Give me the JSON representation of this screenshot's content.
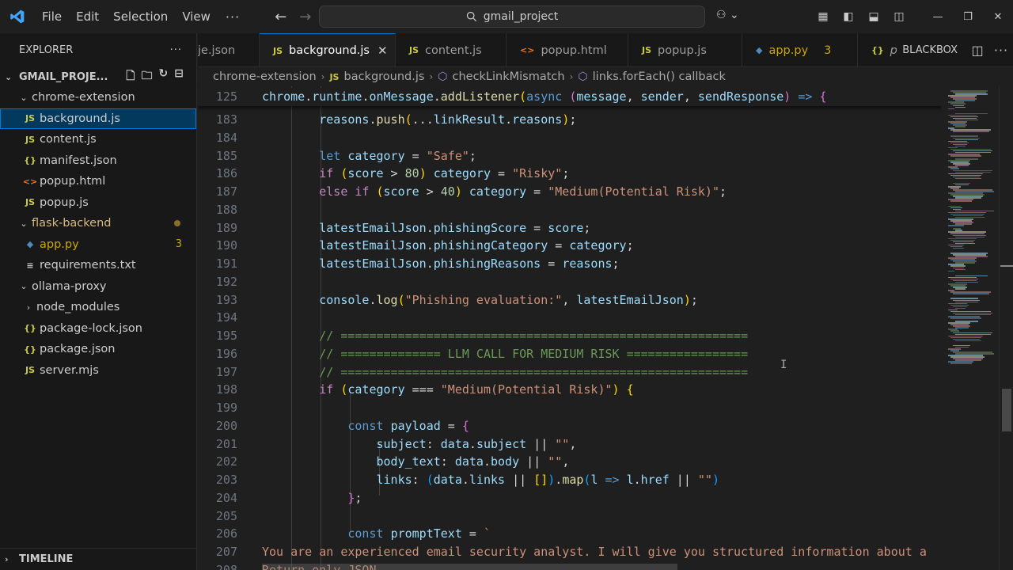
{
  "menu": [
    "File",
    "Edit",
    "Selection",
    "View"
  ],
  "command_center": "gmail_project",
  "sidebar": {
    "header": "EXPLORER",
    "section": "GMAIL_PROJE...",
    "tree": [
      {
        "label": "chrome-extension",
        "kind": "folder",
        "depth": 1,
        "expanded": true
      },
      {
        "label": "background.js",
        "kind": "js",
        "depth": 2,
        "selected": true
      },
      {
        "label": "content.js",
        "kind": "js",
        "depth": 2
      },
      {
        "label": "manifest.json",
        "kind": "json",
        "depth": 2
      },
      {
        "label": "popup.html",
        "kind": "html",
        "depth": 2
      },
      {
        "label": "popup.js",
        "kind": "js",
        "depth": 2
      },
      {
        "label": "flask-backend",
        "kind": "folder",
        "depth": 1,
        "expanded": true,
        "modified": true
      },
      {
        "label": "app.py",
        "kind": "py",
        "depth": 2,
        "badge": "3"
      },
      {
        "label": "requirements.txt",
        "kind": "txt",
        "depth": 2
      },
      {
        "label": "ollama-proxy",
        "kind": "folder",
        "depth": 1,
        "expanded": true
      },
      {
        "label": "node_modules",
        "kind": "folder",
        "depth": 2,
        "expanded": false
      },
      {
        "label": "package-lock.json",
        "kind": "json",
        "depth": 2
      },
      {
        "label": "package.json",
        "kind": "json",
        "depth": 2
      },
      {
        "label": "server.mjs",
        "kind": "js",
        "depth": 2
      }
    ],
    "timeline": "TIMELINE"
  },
  "tabs": [
    {
      "label": "je.json",
      "kind": "none"
    },
    {
      "label": "background.js",
      "kind": "js",
      "active": true
    },
    {
      "label": "content.js",
      "kind": "js"
    },
    {
      "label": "popup.html",
      "kind": "html"
    },
    {
      "label": "popup.js",
      "kind": "js"
    },
    {
      "label": "app.py",
      "kind": "py",
      "badge": "3"
    },
    {
      "label": "p",
      "kind": "json"
    }
  ],
  "blackbox": "BLACKBOX",
  "breadcrumb": [
    "chrome-extension",
    "background.js",
    "checkLinkMismatch",
    "links.forEach() callback"
  ],
  "editor": {
    "sticky": {
      "n": "125",
      "t": [
        [
          "v",
          "chrome"
        ],
        [
          "p",
          "."
        ],
        [
          "v",
          "runtime"
        ],
        [
          "p",
          "."
        ],
        [
          "v",
          "onMessage"
        ],
        [
          "p",
          "."
        ],
        [
          "f",
          "addListener"
        ],
        [
          "b1",
          "("
        ],
        [
          "k",
          "async"
        ],
        [
          "p",
          " "
        ],
        [
          "b2",
          "("
        ],
        [
          "v",
          "message"
        ],
        [
          "p",
          ", "
        ],
        [
          "v",
          "sender"
        ],
        [
          "p",
          ", "
        ],
        [
          "v",
          "sendResponse"
        ],
        [
          "b2",
          ")"
        ],
        [
          "p",
          " "
        ],
        [
          "k",
          "=>"
        ],
        [
          "p",
          " "
        ],
        [
          "b2",
          "{"
        ]
      ]
    },
    "lines": [
      {
        "n": "183",
        "t": [
          [
            "p",
            "        "
          ],
          [
            "v",
            "reasons"
          ],
          [
            "p",
            "."
          ],
          [
            "f",
            "push"
          ],
          [
            "b1",
            "("
          ],
          [
            "p",
            "..."
          ],
          [
            "v",
            "linkResult"
          ],
          [
            "p",
            "."
          ],
          [
            "v",
            "reasons"
          ],
          [
            "b1",
            ")"
          ],
          [
            "p",
            ";"
          ]
        ]
      },
      {
        "n": "184",
        "t": []
      },
      {
        "n": "185",
        "t": [
          [
            "p",
            "        "
          ],
          [
            "k",
            "let"
          ],
          [
            "p",
            " "
          ],
          [
            "v",
            "category"
          ],
          [
            "p",
            " = "
          ],
          [
            "s",
            "\"Safe\""
          ],
          [
            "p",
            ";"
          ]
        ]
      },
      {
        "n": "186",
        "t": [
          [
            "p",
            "        "
          ],
          [
            "c",
            "if"
          ],
          [
            "p",
            " "
          ],
          [
            "b1",
            "("
          ],
          [
            "v",
            "score"
          ],
          [
            "p",
            " > "
          ],
          [
            "n",
            "80"
          ],
          [
            "b1",
            ")"
          ],
          [
            "p",
            " "
          ],
          [
            "v",
            "category"
          ],
          [
            "p",
            " = "
          ],
          [
            "s",
            "\"Risky\""
          ],
          [
            "p",
            ";"
          ]
        ]
      },
      {
        "n": "187",
        "t": [
          [
            "p",
            "        "
          ],
          [
            "c",
            "else"
          ],
          [
            "p",
            " "
          ],
          [
            "c",
            "if"
          ],
          [
            "p",
            " "
          ],
          [
            "b1",
            "("
          ],
          [
            "v",
            "score"
          ],
          [
            "p",
            " > "
          ],
          [
            "n",
            "40"
          ],
          [
            "b1",
            ")"
          ],
          [
            "p",
            " "
          ],
          [
            "v",
            "category"
          ],
          [
            "p",
            " = "
          ],
          [
            "s",
            "\"Medium(Potential Risk)\""
          ],
          [
            "p",
            ";"
          ]
        ]
      },
      {
        "n": "188",
        "t": []
      },
      {
        "n": "189",
        "t": [
          [
            "p",
            "        "
          ],
          [
            "v",
            "latestEmailJson"
          ],
          [
            "p",
            "."
          ],
          [
            "v",
            "phishingScore"
          ],
          [
            "p",
            " = "
          ],
          [
            "v",
            "score"
          ],
          [
            "p",
            ";"
          ]
        ]
      },
      {
        "n": "190",
        "t": [
          [
            "p",
            "        "
          ],
          [
            "v",
            "latestEmailJson"
          ],
          [
            "p",
            "."
          ],
          [
            "v",
            "phishingCategory"
          ],
          [
            "p",
            " = "
          ],
          [
            "v",
            "category"
          ],
          [
            "p",
            ";"
          ]
        ]
      },
      {
        "n": "191",
        "t": [
          [
            "p",
            "        "
          ],
          [
            "v",
            "latestEmailJson"
          ],
          [
            "p",
            "."
          ],
          [
            "v",
            "phishingReasons"
          ],
          [
            "p",
            " = "
          ],
          [
            "v",
            "reasons"
          ],
          [
            "p",
            ";"
          ]
        ]
      },
      {
        "n": "192",
        "t": []
      },
      {
        "n": "193",
        "t": [
          [
            "p",
            "        "
          ],
          [
            "v",
            "console"
          ],
          [
            "p",
            "."
          ],
          [
            "f",
            "log"
          ],
          [
            "b1",
            "("
          ],
          [
            "s",
            "\"Phishing evaluation:\""
          ],
          [
            "p",
            ", "
          ],
          [
            "v",
            "latestEmailJson"
          ],
          [
            "b1",
            ")"
          ],
          [
            "p",
            ";"
          ]
        ]
      },
      {
        "n": "194",
        "t": []
      },
      {
        "n": "195",
        "t": [
          [
            "p",
            "        "
          ],
          [
            "cm",
            "// ========================================================="
          ]
        ]
      },
      {
        "n": "196",
        "t": [
          [
            "p",
            "        "
          ],
          [
            "cm",
            "// ============== LLM CALL FOR MEDIUM RISK ================="
          ]
        ]
      },
      {
        "n": "197",
        "t": [
          [
            "p",
            "        "
          ],
          [
            "cm",
            "// ========================================================="
          ]
        ]
      },
      {
        "n": "198",
        "t": [
          [
            "p",
            "        "
          ],
          [
            "c",
            "if"
          ],
          [
            "p",
            " "
          ],
          [
            "b1",
            "("
          ],
          [
            "v",
            "category"
          ],
          [
            "p",
            " === "
          ],
          [
            "s",
            "\"Medium(Potential Risk)\""
          ],
          [
            "b1",
            ")"
          ],
          [
            "p",
            " "
          ],
          [
            "b1",
            "{"
          ]
        ]
      },
      {
        "n": "199",
        "t": []
      },
      {
        "n": "200",
        "t": [
          [
            "p",
            "            "
          ],
          [
            "k",
            "const"
          ],
          [
            "p",
            " "
          ],
          [
            "v",
            "payload"
          ],
          [
            "p",
            " = "
          ],
          [
            "b2",
            "{"
          ]
        ]
      },
      {
        "n": "201",
        "t": [
          [
            "p",
            "                "
          ],
          [
            "v",
            "subject"
          ],
          [
            "p",
            ": "
          ],
          [
            "v",
            "data"
          ],
          [
            "p",
            "."
          ],
          [
            "v",
            "subject"
          ],
          [
            "p",
            " || "
          ],
          [
            "s",
            "\"\""
          ],
          [
            "p",
            ","
          ]
        ]
      },
      {
        "n": "202",
        "t": [
          [
            "p",
            "                "
          ],
          [
            "v",
            "body_text"
          ],
          [
            "p",
            ": "
          ],
          [
            "v",
            "data"
          ],
          [
            "p",
            "."
          ],
          [
            "v",
            "body"
          ],
          [
            "p",
            " || "
          ],
          [
            "s",
            "\"\""
          ],
          [
            "p",
            ","
          ]
        ]
      },
      {
        "n": "203",
        "t": [
          [
            "p",
            "                "
          ],
          [
            "v",
            "links"
          ],
          [
            "p",
            ": "
          ],
          [
            "b3",
            "("
          ],
          [
            "v",
            "data"
          ],
          [
            "p",
            "."
          ],
          [
            "v",
            "links"
          ],
          [
            "p",
            " || "
          ],
          [
            "b1",
            "[]"
          ],
          [
            "b3",
            ")"
          ],
          [
            "p",
            "."
          ],
          [
            "f",
            "map"
          ],
          [
            "b3",
            "("
          ],
          [
            "v",
            "l"
          ],
          [
            "p",
            " "
          ],
          [
            "k",
            "=>"
          ],
          [
            "p",
            " "
          ],
          [
            "v",
            "l"
          ],
          [
            "p",
            "."
          ],
          [
            "v",
            "href"
          ],
          [
            "p",
            " || "
          ],
          [
            "s",
            "\"\""
          ],
          [
            "b3",
            ")"
          ]
        ]
      },
      {
        "n": "204",
        "t": [
          [
            "p",
            "            "
          ],
          [
            "b2",
            "}"
          ],
          [
            "p",
            ";"
          ]
        ]
      },
      {
        "n": "205",
        "t": []
      },
      {
        "n": "206",
        "t": [
          [
            "p",
            "            "
          ],
          [
            "k",
            "const"
          ],
          [
            "p",
            " "
          ],
          [
            "v",
            "promptText"
          ],
          [
            "p",
            " = "
          ],
          [
            "s",
            "`"
          ]
        ]
      },
      {
        "n": "207",
        "t": [
          [
            "s",
            "You are an experienced email security analyst. I will give you structured information about a"
          ]
        ]
      },
      {
        "n": "208",
        "t": [
          [
            "s",
            "Return only JSON"
          ]
        ]
      }
    ]
  },
  "colors": {
    "accent": "#0078d4",
    "selection": "#04395e",
    "warning": "#cca700"
  }
}
